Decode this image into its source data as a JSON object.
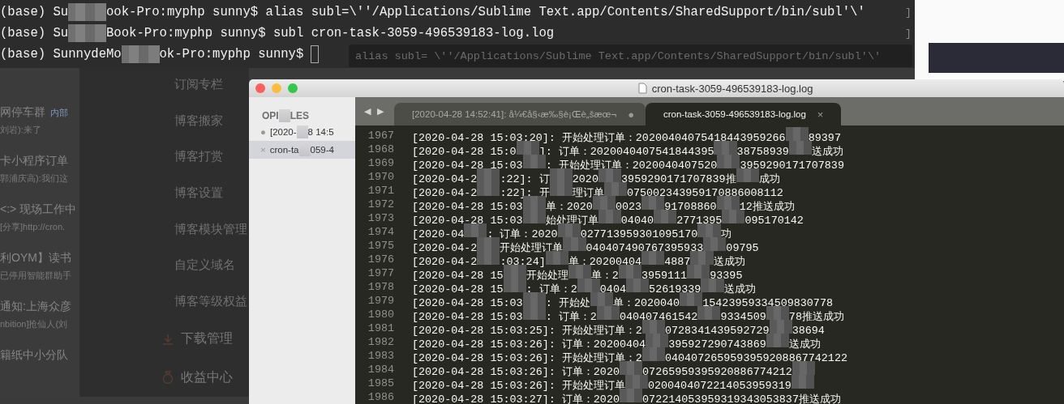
{
  "web_page": {
    "chat_list": [
      {
        "title": "网停车群",
        "badge": "内部",
        "subtitle": "刘岩):来了"
      },
      {
        "title": "卡小程序订单",
        "subtitle": "郭浦庆高):我们这"
      },
      {
        "title": "<:> 现场工作中",
        "subtitle": "[分享]http://cron."
      },
      {
        "title": "利OYM】读书",
        "subtitle": "已停用智能群助手"
      },
      {
        "title": "通知:上海众彦",
        "subtitle": "nbition]抢仙人(刘"
      },
      {
        "title": "籍纸中小分队"
      }
    ],
    "menu": [
      {
        "label": "订阅专栏",
        "kind": "plain"
      },
      {
        "label": "博客搬家",
        "kind": "plain"
      },
      {
        "label": "博客打赏",
        "kind": "plain"
      },
      {
        "label": "博客设置",
        "kind": "plain"
      },
      {
        "label": "博客模块管理",
        "kind": "plain"
      },
      {
        "label": "自定义域名",
        "kind": "plain"
      },
      {
        "label": "博客等级权益",
        "kind": "plain"
      },
      {
        "label": "下载管理",
        "kind": "download"
      },
      {
        "label": "收益中心",
        "kind": "earnings"
      }
    ]
  },
  "terminal": {
    "lines": [
      {
        "parts": [
          {
            "kind": "text",
            "text": "(base) Su"
          },
          {
            "kind": "mosaic"
          },
          {
            "kind": "text",
            "text": "ook-Pro:myphp sunny$ alias subl=\\''/Applications/Sublime Text.app/Contents/SharedSupport/bin/subl'\\'"
          }
        ],
        "end_mark": "]",
        "cursor": false
      },
      {
        "parts": [
          {
            "kind": "text",
            "text": "(base) Su"
          },
          {
            "kind": "mosaic"
          },
          {
            "kind": "text",
            "text": "Book-Pro:myphp sunny$ subl cron-task-3059-496539183-log.log"
          }
        ],
        "end_mark": "]",
        "cursor": false
      },
      {
        "parts": [
          {
            "kind": "text",
            "text": "(base) SunnydeMo"
          },
          {
            "kind": "mosaic"
          },
          {
            "kind": "text",
            "text": "ok-Pro:myphp sunny$"
          }
        ],
        "cursor": true
      }
    ],
    "ghost_hint": "alias subl= \\''/Applications/Sublime Text.app/Contents/SharedSupport/bin/subl'\\'"
  },
  "editor": {
    "title": "cron-task-3059-496539183-log.log",
    "sidebar": {
      "header": [
        {
          "kind": "text",
          "text": "OPI"
        },
        {
          "kind": "mosaic"
        },
        {
          "kind": "text",
          "text": "LES"
        }
      ],
      "files": [
        {
          "mark": "●",
          "selected": false,
          "parts": [
            {
              "kind": "text",
              "text": "[2020-"
            },
            {
              "kind": "mosaic"
            },
            {
              "kind": "text",
              "text": "8 14:5"
            }
          ]
        },
        {
          "mark": "×",
          "selected": true,
          "parts": [
            {
              "kind": "text",
              "text": "cron-ta"
            },
            {
              "kind": "mosaic"
            },
            {
              "kind": "text",
              "text": "059-4"
            }
          ]
        }
      ]
    },
    "nav": "◀ ▶",
    "tabs": [
      {
        "label": "[2020-04-28 14:52:41]: å¼€å§‹æ‰§è¡Œè„šæœ¬",
        "mark": "●",
        "selected": false
      },
      {
        "label": "cron-task-3059-496539183-log.log",
        "mark": "×",
        "selected": true
      }
    ],
    "lines": [
      {
        "number": "1967",
        "parts": [
          {
            "kind": "text",
            "text": "[2020-04-28 15:03:20]: 开始处理订单：20200404075418443959266"
          },
          {
            "kind": "mosaic"
          },
          {
            "kind": "text",
            "text": "89397"
          }
        ]
      },
      {
        "number": "1968",
        "parts": [
          {
            "kind": "text",
            "text": "[2020-04-28 15:0"
          },
          {
            "kind": "mosaic"
          },
          {
            "kind": "text",
            "text": "]: 订单：2020040407541844395"
          },
          {
            "kind": "mosaic"
          },
          {
            "kind": "text",
            "text": "38758939"
          },
          {
            "kind": "mosaic"
          },
          {
            "kind": "text",
            "text": "送成功"
          }
        ]
      },
      {
        "number": "1969",
        "parts": [
          {
            "kind": "text",
            "text": "[2020-04-28 15:03"
          },
          {
            "kind": "mosaic"
          },
          {
            "kind": "text",
            "text": ": 开始处理订单：2020040407520"
          },
          {
            "kind": "mosaic"
          },
          {
            "kind": "text",
            "text": "3959290171707839"
          }
        ]
      },
      {
        "number": "1970",
        "parts": [
          {
            "kind": "text",
            "text": "[2020-04-2"
          },
          {
            "kind": "mosaic"
          },
          {
            "kind": "text",
            "text": ":22]: 订"
          },
          {
            "kind": "mosaic"
          },
          {
            "kind": "text",
            "text": "2020"
          },
          {
            "kind": "mosaic"
          },
          {
            "kind": "text",
            "text": "3959290171707839推"
          },
          {
            "kind": "mosaic"
          },
          {
            "kind": "text",
            "text": "成功"
          }
        ]
      },
      {
        "number": "1971",
        "parts": [
          {
            "kind": "text",
            "text": "[2020-04-2"
          },
          {
            "kind": "mosaic"
          },
          {
            "kind": "text",
            "text": ":22]: 开"
          },
          {
            "kind": "mosaic"
          },
          {
            "kind": "text",
            "text": "理订单"
          },
          {
            "kind": "mosaic"
          },
          {
            "kind": "text",
            "text": "075002343959170886008112"
          }
        ]
      },
      {
        "number": "1972",
        "parts": [
          {
            "kind": "text",
            "text": "[2020-04-28 15:03"
          },
          {
            "kind": "mosaic"
          },
          {
            "kind": "text",
            "text": "单：2020"
          },
          {
            "kind": "mosaic"
          },
          {
            "kind": "text",
            "text": "0023"
          },
          {
            "kind": "mosaic"
          },
          {
            "kind": "text",
            "text": "91708860"
          },
          {
            "kind": "mosaic"
          },
          {
            "kind": "text",
            "text": "12推送成功"
          }
        ]
      },
      {
        "number": "1973",
        "parts": [
          {
            "kind": "text",
            "text": "[2020-04-28 15:03"
          },
          {
            "kind": "mosaic"
          },
          {
            "kind": "text",
            "text": "始处理订单"
          },
          {
            "kind": "mosaic"
          },
          {
            "kind": "text",
            "text": "04040"
          },
          {
            "kind": "mosaic"
          },
          {
            "kind": "text",
            "text": "2771395"
          },
          {
            "kind": "mosaic"
          },
          {
            "kind": "text",
            "text": "095170142"
          }
        ]
      },
      {
        "number": "1974",
        "parts": [
          {
            "kind": "text",
            "text": "[2020-04"
          },
          {
            "kind": "mosaic"
          },
          {
            "kind": "text",
            "text": ": 订单：2020"
          },
          {
            "kind": "mosaic"
          },
          {
            "kind": "text",
            "text": "027713959301095170"
          },
          {
            "kind": "mosaic"
          },
          {
            "kind": "text",
            "text": "功"
          }
        ]
      },
      {
        "number": "1975",
        "parts": [
          {
            "kind": "text",
            "text": "[2020-04-2"
          },
          {
            "kind": "mosaic"
          },
          {
            "kind": "text",
            "text": "开始处理订单"
          },
          {
            "kind": "mosaic"
          },
          {
            "kind": "text",
            "text": "040407490767395933"
          },
          {
            "kind": "mosaic"
          },
          {
            "kind": "text",
            "text": "09795"
          }
        ]
      },
      {
        "number": "1976",
        "parts": [
          {
            "kind": "text",
            "text": "[2020-04-2"
          },
          {
            "kind": "mosaic"
          },
          {
            "kind": "text",
            "text": ":03:24]"
          },
          {
            "kind": "mosaic"
          },
          {
            "kind": "text",
            "text": "单：20200404"
          },
          {
            "kind": "mosaic"
          },
          {
            "kind": "text",
            "text": "4887"
          },
          {
            "kind": "mosaic"
          },
          {
            "kind": "text",
            "text": "送成功"
          }
        ]
      },
      {
        "number": "1977",
        "parts": [
          {
            "kind": "text",
            "text": "[2020-04-28 15"
          },
          {
            "kind": "mosaic"
          },
          {
            "kind": "text",
            "text": "开始处理"
          },
          {
            "kind": "mosaic"
          },
          {
            "kind": "text",
            "text": "单：2"
          },
          {
            "kind": "mosaic"
          },
          {
            "kind": "text",
            "text": "3959111"
          },
          {
            "kind": "mosaic"
          },
          {
            "kind": "text",
            "text": "93395"
          }
        ]
      },
      {
        "number": "1978",
        "parts": [
          {
            "kind": "text",
            "text": "[2020-04-28 15"
          },
          {
            "kind": "mosaic"
          },
          {
            "kind": "text",
            "text": ": 订单：2"
          },
          {
            "kind": "mosaic"
          },
          {
            "kind": "text",
            "text": "0404"
          },
          {
            "kind": "mosaic"
          },
          {
            "kind": "text",
            "text": "52619339"
          },
          {
            "kind": "mosaic"
          },
          {
            "kind": "text",
            "text": "送成功"
          }
        ]
      },
      {
        "number": "1979",
        "parts": [
          {
            "kind": "text",
            "text": "[2020-04-28 15:03"
          },
          {
            "kind": "mosaic"
          },
          {
            "kind": "text",
            "text": ": 开始处"
          },
          {
            "kind": "mosaic"
          },
          {
            "kind": "text",
            "text": "单：2020040"
          },
          {
            "kind": "mosaic"
          },
          {
            "kind": "text",
            "text": "15423959334509830778"
          }
        ]
      },
      {
        "number": "1980",
        "parts": [
          {
            "kind": "text",
            "text": "[2020-04-28 15:03"
          },
          {
            "kind": "mosaic"
          },
          {
            "kind": "text",
            "text": ": 订单：2"
          },
          {
            "kind": "mosaic"
          },
          {
            "kind": "text",
            "text": "040407461542"
          },
          {
            "kind": "mosaic"
          },
          {
            "kind": "text",
            "text": "9334509"
          },
          {
            "kind": "mosaic"
          },
          {
            "kind": "text",
            "text": "78推送成功"
          }
        ]
      },
      {
        "number": "1981",
        "parts": [
          {
            "kind": "text",
            "text": "[2020-04-28 15:03:25]: 开始处理订单：2"
          },
          {
            "kind": "mosaic"
          },
          {
            "kind": "text",
            "text": "0728341439592729"
          },
          {
            "kind": "mosaic"
          },
          {
            "kind": "text",
            "text": "38694"
          }
        ]
      },
      {
        "number": "1982",
        "parts": [
          {
            "kind": "text",
            "text": "[2020-04-28 15:03:26]: 订单：20200404"
          },
          {
            "kind": "mosaic"
          },
          {
            "kind": "text",
            "text": "395927290743869"
          },
          {
            "kind": "mosaic"
          },
          {
            "kind": "text",
            "text": "送成功"
          }
        ]
      },
      {
        "number": "1983",
        "parts": [
          {
            "kind": "text",
            "text": "[2020-04-28 15:03:26]: 开始处理订单：2"
          },
          {
            "kind": "mosaic"
          },
          {
            "kind": "text",
            "text": "0404072659593959208867742122"
          }
        ]
      },
      {
        "number": "1984",
        "parts": [
          {
            "kind": "text",
            "text": "[2020-04-28 15:03:26]: 订单：2020"
          },
          {
            "kind": "mosaic"
          },
          {
            "kind": "text",
            "text": "07265959395920886774212"
          },
          {
            "kind": "mosaic"
          }
        ]
      },
      {
        "number": "1985",
        "parts": [
          {
            "kind": "text",
            "text": "[2020-04-28 15:03:26]: 开始处理订单"
          },
          {
            "kind": "mosaic"
          },
          {
            "kind": "text",
            "text": "0200404072214053959319"
          },
          {
            "kind": "mosaic"
          }
        ]
      },
      {
        "number": "1986",
        "parts": [
          {
            "kind": "text",
            "text": "[2020-04-28 15:03:27]: 订单：2020"
          },
          {
            "kind": "mosaic"
          },
          {
            "kind": "text",
            "text": "072214053959319343053837推送成功"
          }
        ]
      }
    ]
  }
}
